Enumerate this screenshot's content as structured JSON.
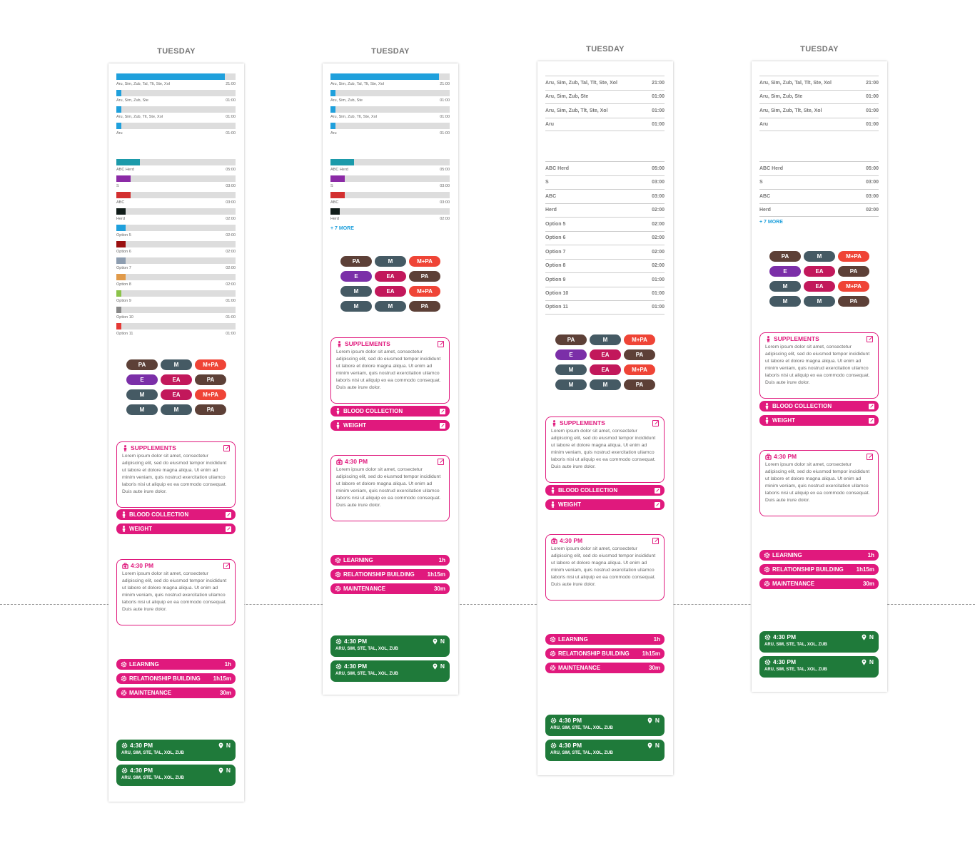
{
  "day_label": "TUESDAY",
  "colors": {
    "magenta": "#e0197d",
    "green": "#1f7a3a",
    "grey_track": "#dddddd",
    "accent_blue": "#1fa0dc"
  },
  "group1": [
    {
      "label": "Aru, Sim, Zub, Tal, Tlt, Ste, Xol",
      "value": "21:00",
      "fill": 0.91,
      "color": "#1fa0dc"
    },
    {
      "label": "Aru, Sim, Zub, Ste",
      "value": "01:00",
      "fill": 0.04,
      "color": "#1fa0dc"
    },
    {
      "label": "Aru, Sim, Zub, Tlt, Ste, Xol",
      "value": "01:00",
      "fill": 0.04,
      "color": "#1fa0dc"
    },
    {
      "label": "Aru",
      "value": "01:00",
      "fill": 0.04,
      "color": "#1fa0dc"
    }
  ],
  "group2": [
    {
      "label": "ABC Herd",
      "value": "05:00",
      "fill": 0.2,
      "color": "#1b9aaa"
    },
    {
      "label": "S",
      "value": "03:00",
      "fill": 0.12,
      "color": "#8b2aa6"
    },
    {
      "label": "ABC",
      "value": "03:00",
      "fill": 0.12,
      "color": "#d32f2f"
    },
    {
      "label": "Herd",
      "value": "02:00",
      "fill": 0.08,
      "color": "#111d1a"
    },
    {
      "label": "Option 5",
      "value": "02:00",
      "fill": 0.08,
      "color": "#1fa0dc"
    },
    {
      "label": "Option 6",
      "value": "02:00",
      "fill": 0.08,
      "color": "#9a0f0f"
    },
    {
      "label": "Option 7",
      "value": "02:00",
      "fill": 0.08,
      "color": "#8d9db0"
    },
    {
      "label": "Option 8",
      "value": "02:00",
      "fill": 0.08,
      "color": "#e09a4a"
    },
    {
      "label": "Option 9",
      "value": "01:00",
      "fill": 0.04,
      "color": "#8bc34a"
    },
    {
      "label": "Option 10",
      "value": "01:00",
      "fill": 0.04,
      "color": "#888888"
    },
    {
      "label": "Option 11",
      "value": "01:00",
      "fill": 0.04,
      "color": "#e53935"
    }
  ],
  "col4_group2": [
    {
      "label": "ABC Herd",
      "value": "05:00"
    },
    {
      "label": "S",
      "value": "03:00"
    },
    {
      "label": "ABC",
      "value": "03:00"
    },
    {
      "label": "Herd",
      "value": "02:00"
    }
  ],
  "more_label": "+ 7 MORE",
  "pills": [
    {
      "text": "PA",
      "color": "#5d4037"
    },
    {
      "text": "M",
      "color": "#455a64"
    },
    {
      "text": "M+PA",
      "color": "#ef4436"
    },
    {
      "text": "E",
      "color": "#7b2fa8"
    },
    {
      "text": "EA",
      "color": "#c2185b"
    },
    {
      "text": "PA",
      "color": "#5d4037"
    },
    {
      "text": "M",
      "color": "#455a64"
    },
    {
      "text": "EA",
      "color": "#c2185b"
    },
    {
      "text": "M+PA",
      "color": "#ef4436"
    },
    {
      "text": "M",
      "color": "#455a64"
    },
    {
      "text": "M",
      "color": "#455a64"
    },
    {
      "text": "PA",
      "color": "#5d4037"
    }
  ],
  "supplements": {
    "title": "SUPPLEMENTS",
    "body": "Lorem ipsum dolor sit amet, consectetur adipiscing elit, sed do eiusmod tempor incididunt ut labore et dolore magna aliqua. Ut enim ad minim veniam, quis nostrud exercitation ullamco laboris nisi ut aliquip ex ea commodo consequat. Duis aute irure dolor."
  },
  "blood_collection": "BLOOD COLLECTION",
  "weight": "WEIGHT",
  "appointment": {
    "time": "4:30 PM",
    "body": "Lorem ipsum dolor sit amet, consectetur adipiscing elit, sed do eiusmod tempor incididunt ut labore et dolore magna aliqua. Ut enim ad minim veniam, quis nostrud exercitation ullamco laboris nisi ut aliquip ex ea commodo consequat. Duis aute irure dolor."
  },
  "activities": [
    {
      "label": "LEARNING",
      "value": "1h"
    },
    {
      "label": "RELATIONSHIP BUILDING",
      "value": "1h15m"
    },
    {
      "label": "MAINTENANCE",
      "value": "30m"
    }
  ],
  "green_event": {
    "time": "4:30 PM",
    "location": "N",
    "names": "ARU, SIM, STE, TAL, XOL, ZUB"
  }
}
